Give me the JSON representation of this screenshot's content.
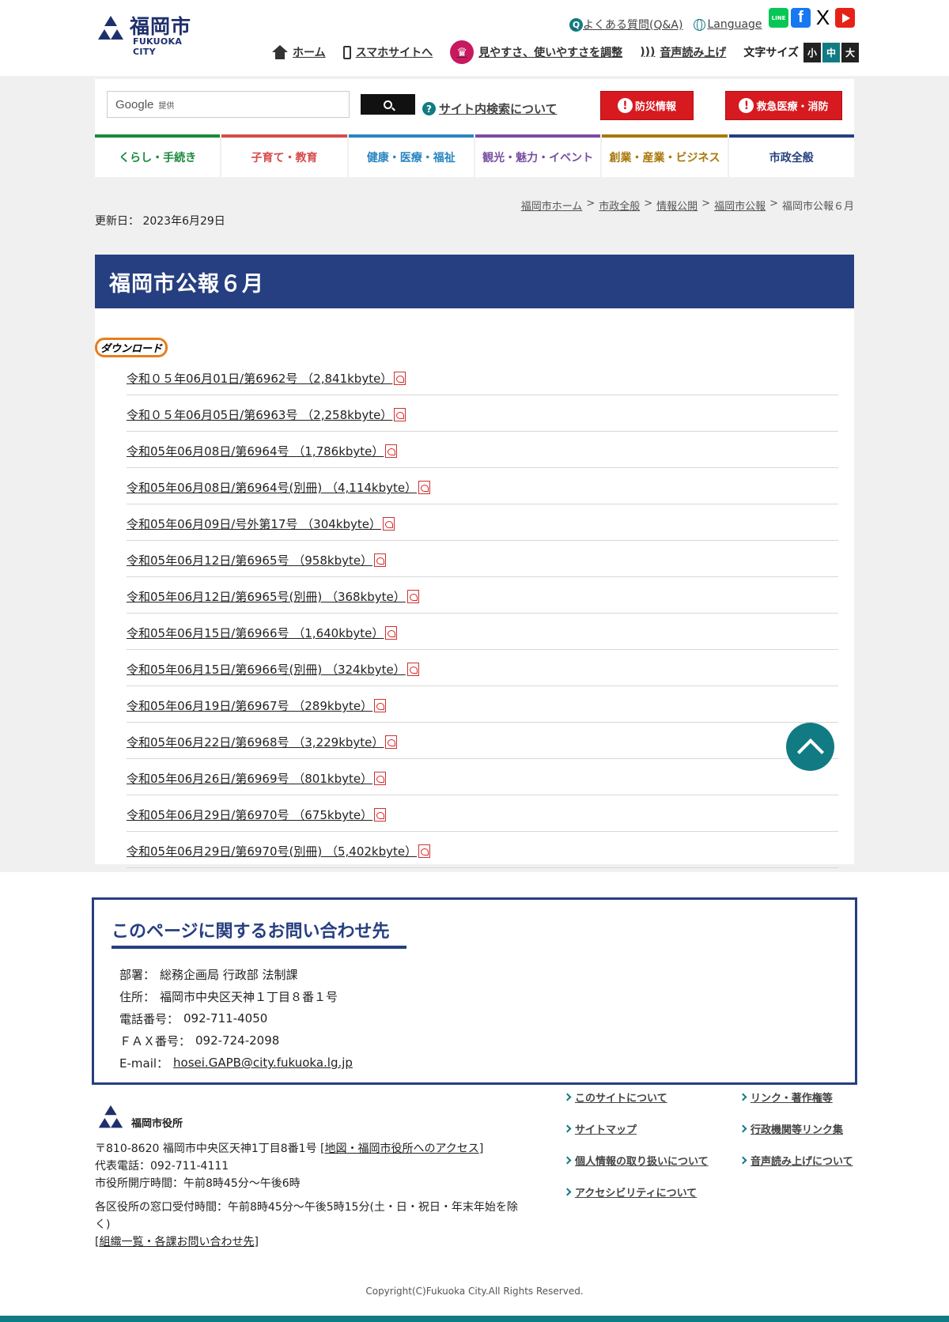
{
  "header": {
    "logo_text": "福岡市",
    "logo_sub": "FUKUOKA CITY",
    "top_links": [
      "よくある質問(Q&A)",
      "Language"
    ],
    "faq_icon_letter": "Q",
    "sns": {
      "line": "LINE",
      "facebook": "f",
      "x": "X"
    },
    "utility_nav": {
      "home": "ホーム",
      "smartphone": "スマホサイトへ",
      "accessibility": "見やすさ、使いやすさを調整",
      "read_aloud": "音声読み上げ"
    },
    "font_size": {
      "label": "文字サイズ",
      "small": "小",
      "medium": "中",
      "large": "大"
    }
  },
  "search": {
    "google_label": "Google",
    "provided_label": "提供",
    "about_label": "サイト内検索について"
  },
  "alerts": {
    "disaster": "防災情報",
    "emergency": "救急医療・消防"
  },
  "global_nav": [
    {
      "label": "くらし・手続き",
      "color": "#1a8a3a"
    },
    {
      "label": "子育て・教育",
      "color": "#d64b4b"
    },
    {
      "label": "健康・医療・福祉",
      "color": "#2a86c2"
    },
    {
      "label": "観光・魅力・イベント",
      "color": "#7a4ea3"
    },
    {
      "label": "創業・産業・ビジネス",
      "color": "#a8780a"
    },
    {
      "label": "市政全般",
      "color": "#263f80"
    }
  ],
  "breadcrumb": {
    "items": [
      "福岡市ホーム",
      "市政全般",
      "情報公開",
      "福岡市公報"
    ],
    "current": "福岡市公報６月",
    "separator": ">"
  },
  "updated": "更新日： 2023年6月29日",
  "page_title": "福岡市公報６月",
  "download_label": "ダウンロード",
  "files": [
    "令和０５年06月01日/第6962号 （2,841kbyte）",
    "令和０５年06月05日/第6963号 （2,258kbyte）",
    "令和05年06月08日/第6964号 （1,786kbyte）",
    "令和05年06月08日/第6964号(別冊) （4,114kbyte）",
    "令和05年06月09日/号外第17号 （304kbyte）",
    "令和05年06月12日/第6965号 （958kbyte）",
    "令和05年06月12日/第6965号(別冊) （368kbyte）",
    "令和05年06月15日/第6966号 （1,640kbyte）",
    "令和05年06月15日/第6966号(別冊) （324kbyte）",
    "令和05年06月19日/第6967号 （289kbyte）",
    "令和05年06月22日/第6968号 （3,229kbyte）",
    "令和05年06月26日/第6969号 （801kbyte）",
    "令和05年06月29日/第6970号 （675kbyte）",
    "令和05年06月29日/第6970号(別冊) （5,402kbyte）"
  ],
  "contact": {
    "title": "このページに関するお問い合わせ先",
    "department_label": "部署：",
    "department": "総務企画局 行政部 法制課",
    "address_label": "住所：",
    "address": "福岡市中央区天神１丁目８番１号",
    "phone_label": "電話番号：",
    "phone": "092-711-4050",
    "fax_label": "ＦＡＸ番号：",
    "fax": "092-724-2098",
    "email_label": "E-mail：",
    "email": "hosei.GAPB@city.fukuoka.lg.jp"
  },
  "footer": {
    "office_name": "福岡市役所",
    "address_prefix": "〒810-8620 福岡市中央区天神1丁目8番1号 [",
    "access_link": "地図・福岡市役所へのアクセス",
    "bracket_close": "]",
    "main_phone": "代表電話：092-711-4111",
    "hours": "市役所開庁時間：午前8時45分～午後6時",
    "ward_hours": "各区役所の窓口受付時間：午前8時45分～午後5時15分(土・日・祝日・年末年始を除く)",
    "org_link": "組織一覧・各課お問い合わせ先",
    "bracket_open": "[",
    "links": [
      "このサイトについて",
      "リンク・著作権等",
      "サイトマップ",
      "行政機関等リンク集",
      "個人情報の取り扱いについて",
      "音声読み上げについて",
      "アクセシビリティについて"
    ],
    "copyright": "Copyright(C)Fukuoka City.All Rights Reserved."
  }
}
